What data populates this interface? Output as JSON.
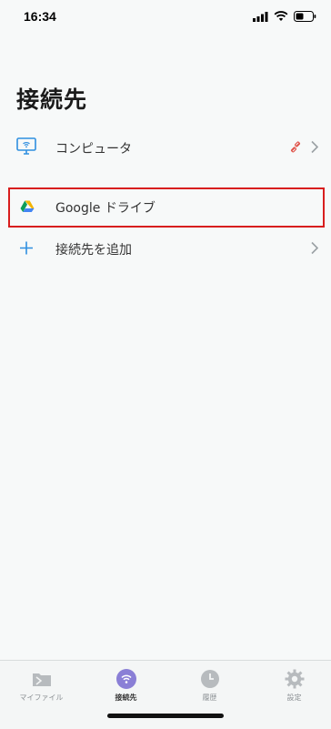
{
  "status": {
    "time": "16:34"
  },
  "page": {
    "title": "接続先"
  },
  "connections": [
    {
      "label": "コンピュータ"
    },
    {
      "label": "Google ドライブ"
    },
    {
      "label": "接続先を追加"
    }
  ],
  "tabs": [
    {
      "label": "マイファイル",
      "icon": "folder-icon"
    },
    {
      "label": "接続先",
      "icon": "wifi-icon"
    },
    {
      "label": "履歴",
      "icon": "clock-icon"
    },
    {
      "label": "設定",
      "icon": "gear-icon"
    }
  ],
  "colors": {
    "accent_blue": "#2f8fe0",
    "tab_active": "#8a7fd6",
    "highlight_red": "#d81e1e"
  }
}
